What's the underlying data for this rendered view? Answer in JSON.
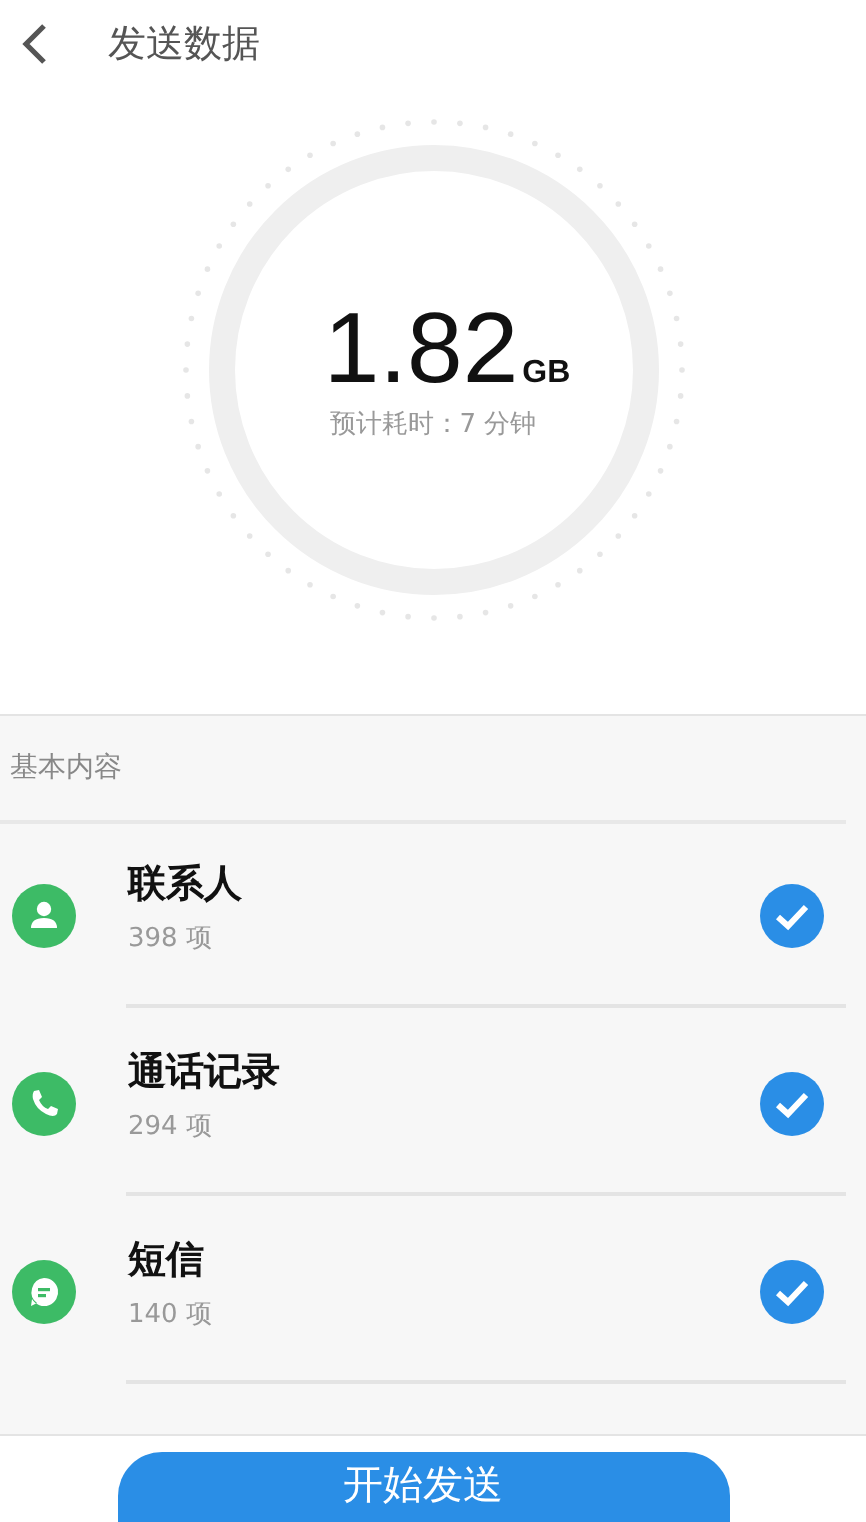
{
  "header": {
    "title": "发送数据"
  },
  "summary": {
    "size": "1.82",
    "unit": "GB",
    "estimate": "预计耗时：7 分钟"
  },
  "section": {
    "title": "基本内容"
  },
  "items": [
    {
      "kind": "contacts",
      "name": "联系人",
      "count": "398 项",
      "checked": true
    },
    {
      "kind": "calls",
      "name": "通话记录",
      "count": "294 项",
      "checked": true
    },
    {
      "kind": "messages",
      "name": "短信",
      "count": "140 项",
      "checked": true
    }
  ],
  "button": {
    "label": "开始发送"
  }
}
